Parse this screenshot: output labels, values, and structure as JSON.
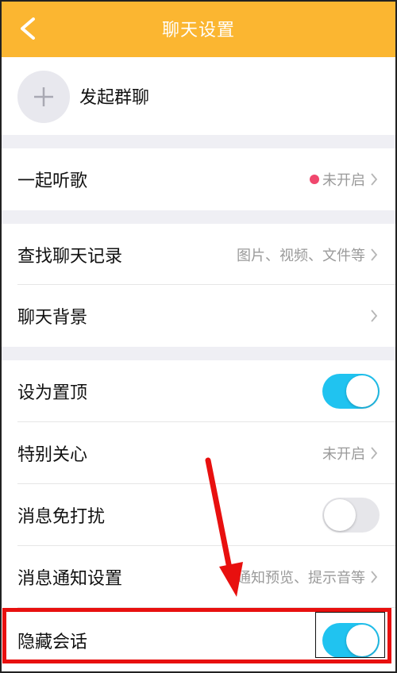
{
  "header": {
    "title": "聊天设置",
    "back_icon": "chevron-left-icon"
  },
  "group_chat": {
    "label": "发起群聊",
    "icon": "plus-icon"
  },
  "listen_together": {
    "label": "一起听歌",
    "value": "未开启",
    "dot_color": "#f0476d"
  },
  "search_history": {
    "label": "查找聊天记录",
    "value": "图片、视频、文件等"
  },
  "chat_background": {
    "label": "聊天背景"
  },
  "pin_top": {
    "label": "设为置顶",
    "enabled": true
  },
  "special_care": {
    "label": "特别关心",
    "value": "未开启"
  },
  "do_not_disturb": {
    "label": "消息免打扰",
    "enabled": false
  },
  "notification_settings": {
    "label": "消息通知设置",
    "value": "通知预览、提示音等"
  },
  "hide_chat": {
    "label": "隐藏会话",
    "enabled": true
  },
  "colors": {
    "header": "#fbb631",
    "toggle_on": "#20c3f0",
    "annotation": "#e8100f"
  }
}
